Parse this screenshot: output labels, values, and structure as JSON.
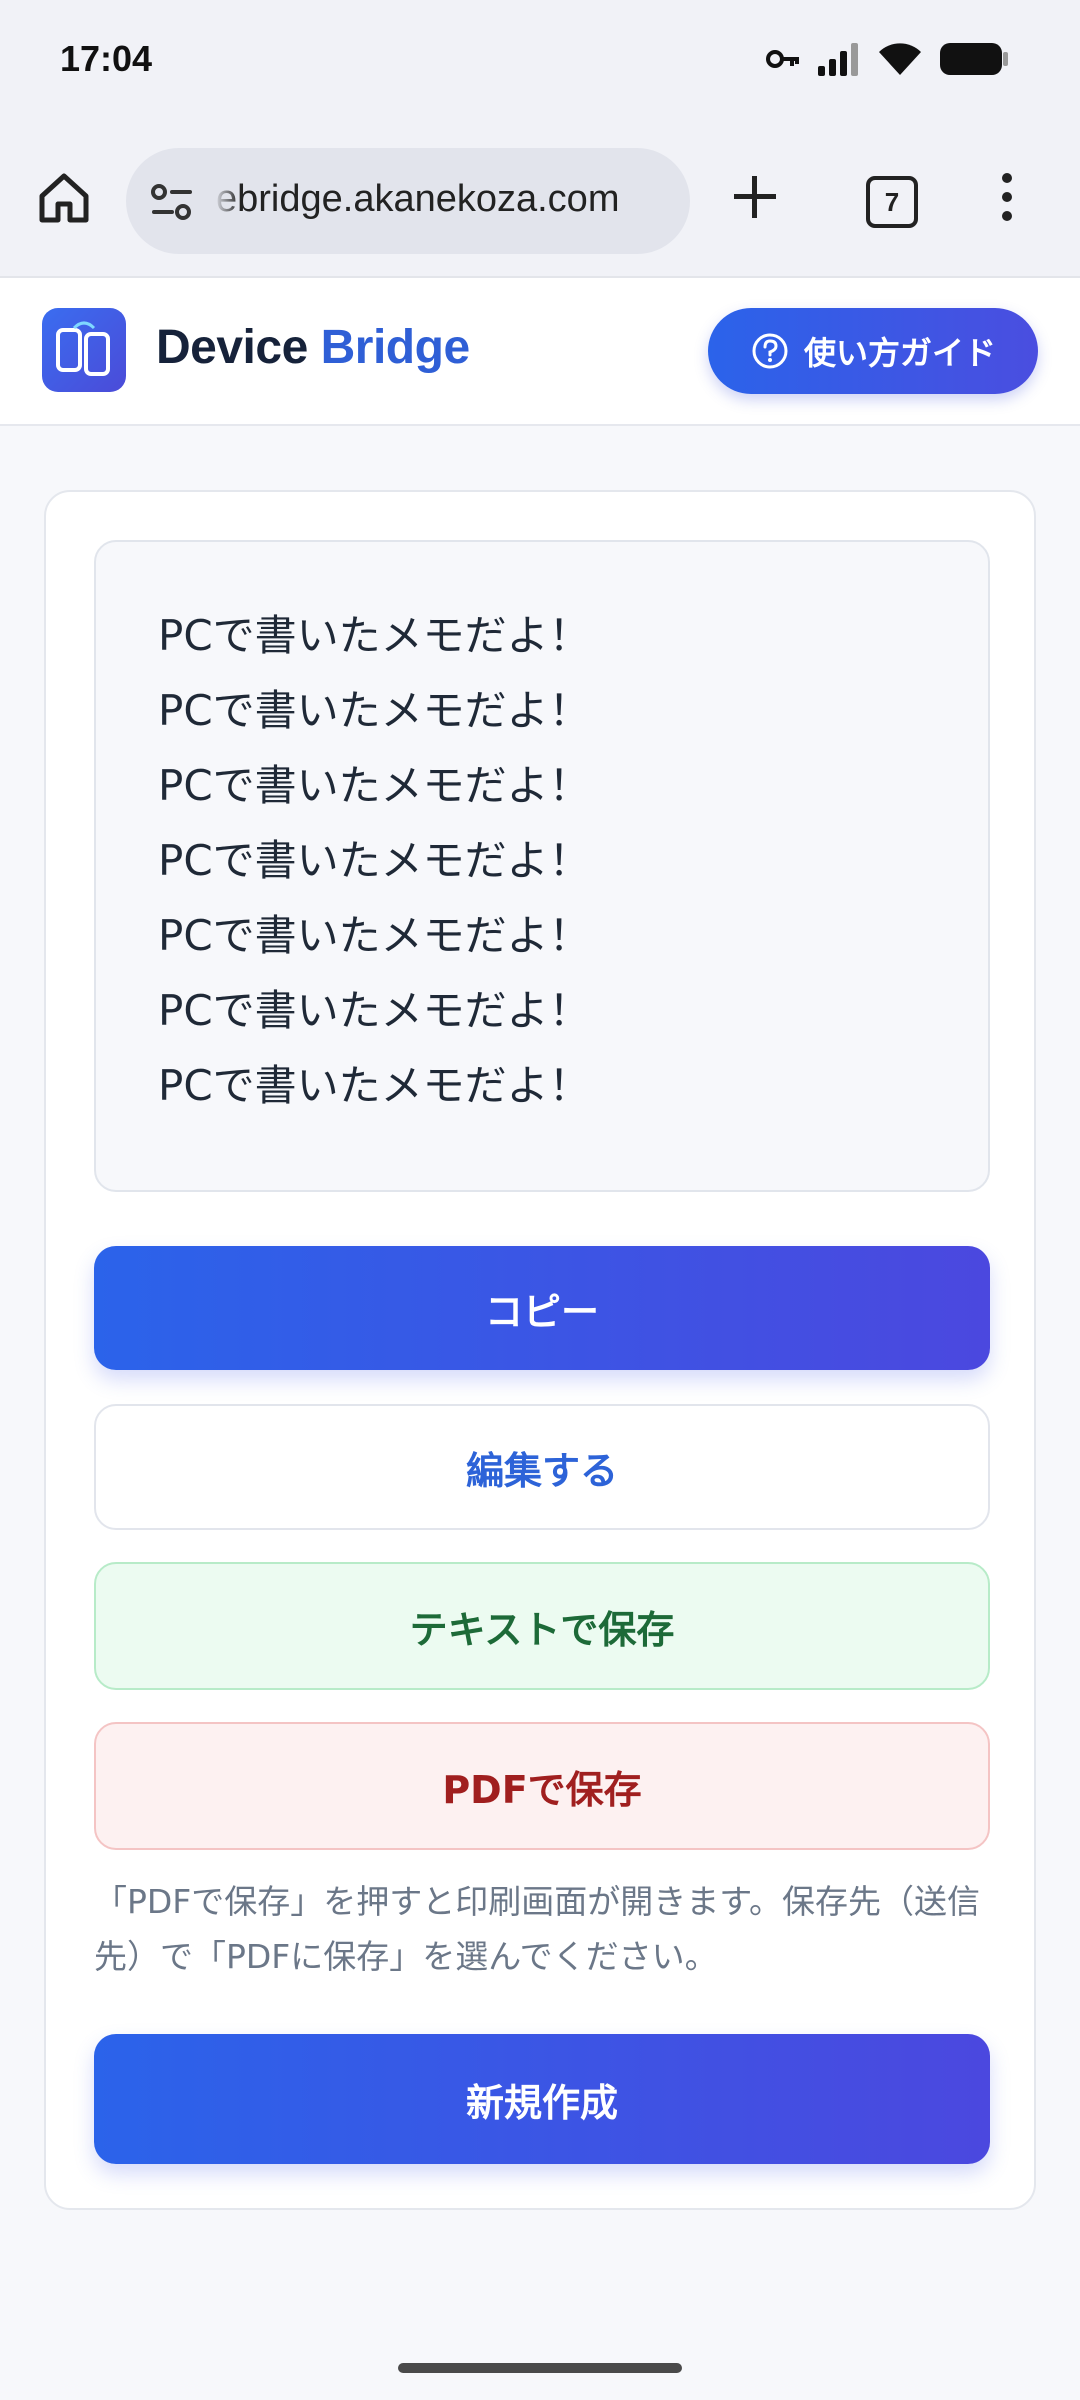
{
  "status_bar": {
    "time": "17:04"
  },
  "browser": {
    "url": "ebridge.akanekoza.com",
    "tab_count": "7"
  },
  "header": {
    "brand_part1": "Device",
    "brand_part2": "Bridge",
    "guide_label": "使い方ガイド"
  },
  "memo": {
    "lines": [
      "PCで書いたメモだよ！",
      "PCで書いたメモだよ！",
      "PCで書いたメモだよ！",
      "PCで書いたメモだよ！",
      "PCで書いたメモだよ！",
      "PCで書いたメモだよ！",
      "PCで書いたメモだよ！"
    ]
  },
  "actions": {
    "copy": "コピー",
    "edit": "編集する",
    "save_text": "テキストで保存",
    "save_pdf": "PDFで保存",
    "pdf_note": "「PDFで保存」を押すと印刷画面が開きます。保存先（送信先）で「PDFに保存」を選んでください。",
    "new": "新規作成"
  },
  "colors": {
    "accent": "#2b63ea",
    "accent2": "#4b48df",
    "green": "#1d6a38",
    "red": "#a01f1f"
  }
}
